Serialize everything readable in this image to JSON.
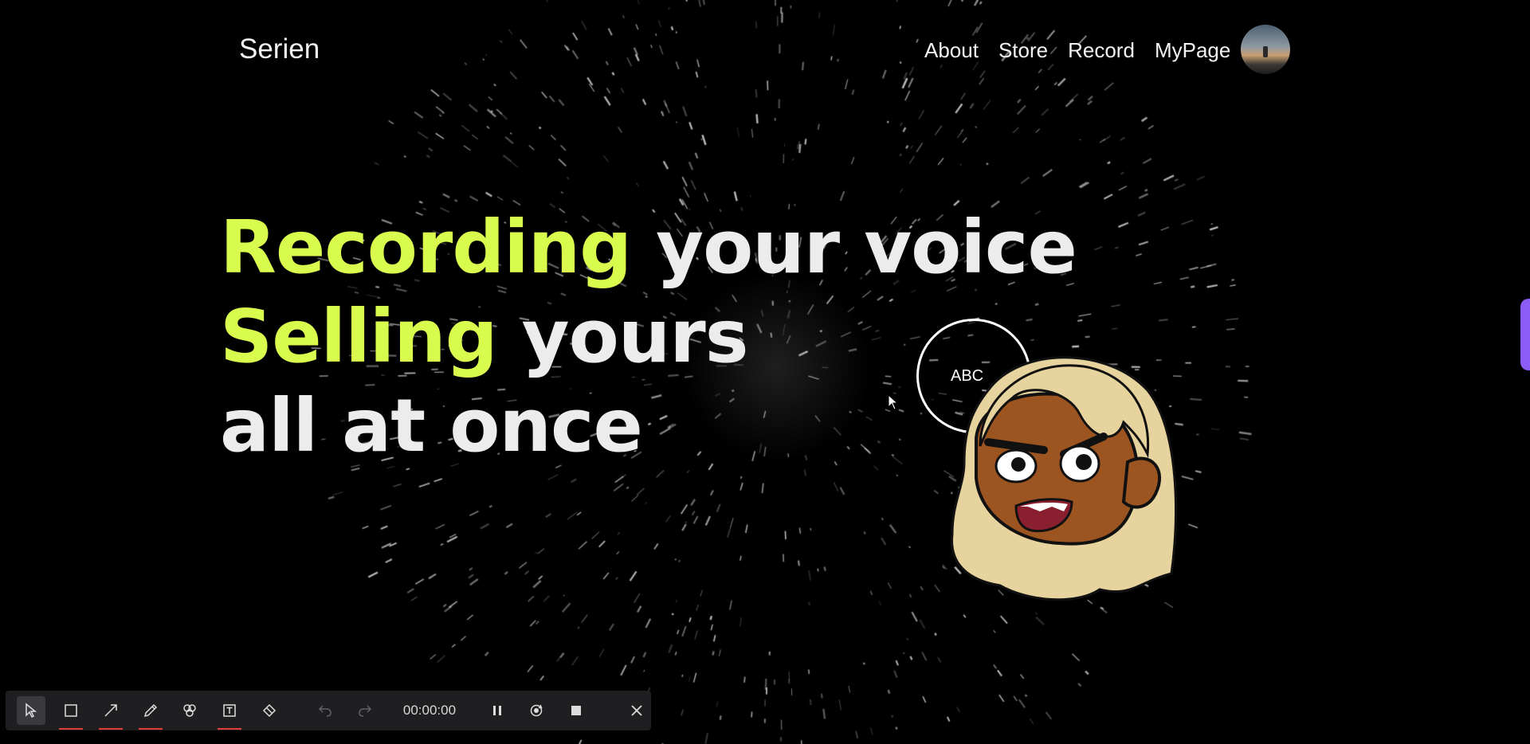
{
  "app": {
    "logo": "Serien",
    "nav": [
      "About",
      "Store",
      "Record",
      "MyPage"
    ]
  },
  "hero": {
    "line1": {
      "highlight": "Recording",
      "rest": " your voice"
    },
    "line2": {
      "highlight": "Selling",
      "rest": " yours"
    },
    "line3": "all at once"
  },
  "badge": {
    "label": "ABC"
  },
  "colors": {
    "accent": "#d9fb4e",
    "text": "#ececec",
    "background": "#000000",
    "side_tab": "#8b5cf6",
    "toolbar_bg": "#1f1f22",
    "tool_underline": "#e23b3b"
  },
  "recorder": {
    "timer": "00:00:00",
    "tools": [
      "select-icon",
      "rectangle-icon",
      "arrow-icon",
      "pen-icon",
      "highlighter-icon",
      "text-icon",
      "eraser-icon"
    ],
    "actions": [
      "undo-icon",
      "redo-icon",
      "pause-icon",
      "restart-icon",
      "stop-icon",
      "close-icon"
    ]
  }
}
